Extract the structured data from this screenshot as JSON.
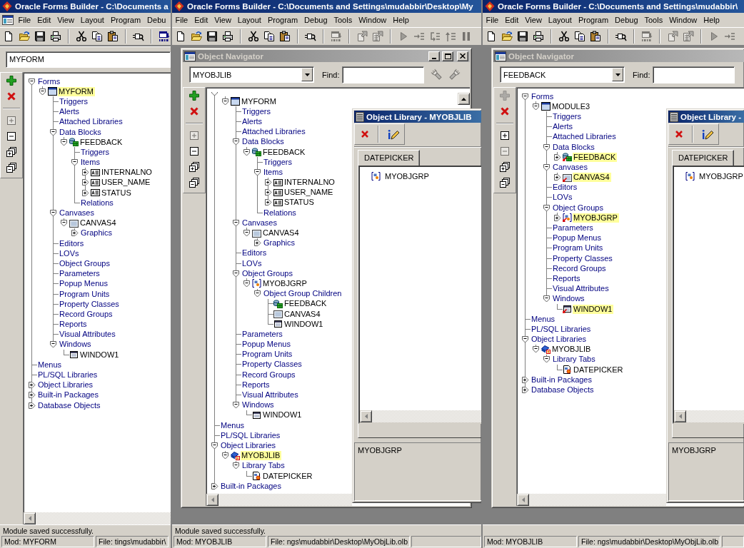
{
  "panels": [
    {
      "app_title": "Oracle Forms Builder - C:\\Documents a",
      "menu": [
        "File",
        "Edit",
        "View",
        "Layout",
        "Program",
        "Debu"
      ],
      "toolbar": [
        {
          "disabled": false
        },
        {
          "disabled": false
        },
        {
          "disabled": false
        },
        {
          "disabled": false
        },
        {
          "disabled": false
        },
        {
          "disabled": false
        },
        {
          "disabled": false
        },
        {
          "disabled": false
        },
        {
          "disabled": false
        }
      ],
      "navigator": {
        "maximized": true,
        "module": "MYFORM",
        "tools": [
          {
            "disabled": false
          },
          {
            "disabled": false
          },
          {
            "disabled": true
          },
          {
            "disabled": false
          },
          {
            "disabled": false
          },
          {
            "disabled": false
          }
        ],
        "tree": [
          {
            "label": "Forms",
            "kind": "category",
            "selected": false,
            "expanded": true,
            "children": [
              {
                "label": "MYFORM",
                "kind": "form",
                "selected": true,
                "subclassed": false,
                "expanded": true,
                "children": [
                  {
                    "label": "Triggers",
                    "kind": "category",
                    "selected": false
                  },
                  {
                    "label": "Alerts",
                    "kind": "category",
                    "selected": false
                  },
                  {
                    "label": "Attached Libraries",
                    "kind": "category",
                    "selected": false
                  },
                  {
                    "label": "Data Blocks",
                    "kind": "category",
                    "selected": false,
                    "expanded": true,
                    "children": [
                      {
                        "label": "FEEDBACK",
                        "kind": "block",
                        "selected": false,
                        "subclassed": false,
                        "expanded": true,
                        "children": [
                          {
                            "label": "Triggers",
                            "kind": "category",
                            "selected": false
                          },
                          {
                            "label": "Items",
                            "kind": "category",
                            "selected": false,
                            "expanded": true,
                            "children": [
                              {
                                "label": "INTERNALNO",
                                "kind": "item",
                                "selected": false,
                                "subclassed": false,
                                "expanded": false
                              },
                              {
                                "label": "USER_NAME",
                                "kind": "item",
                                "selected": false,
                                "subclassed": false,
                                "expanded": false
                              },
                              {
                                "label": "STATUS",
                                "kind": "item",
                                "selected": false,
                                "subclassed": false,
                                "expanded": false
                              }
                            ]
                          },
                          {
                            "label": "Relations",
                            "kind": "category",
                            "selected": false
                          }
                        ]
                      }
                    ]
                  },
                  {
                    "label": "Canvases",
                    "kind": "category",
                    "selected": false,
                    "expanded": true,
                    "children": [
                      {
                        "label": "CANVAS4",
                        "kind": "canvas",
                        "selected": false,
                        "subclassed": false,
                        "expanded": true,
                        "children": [
                          {
                            "label": "Graphics",
                            "kind": "category",
                            "selected": false,
                            "expanded": false
                          }
                        ]
                      }
                    ]
                  },
                  {
                    "label": "Editors",
                    "kind": "category",
                    "selected": false
                  },
                  {
                    "label": "LOVs",
                    "kind": "category",
                    "selected": false
                  },
                  {
                    "label": "Object Groups",
                    "kind": "category",
                    "selected": false
                  },
                  {
                    "label": "Parameters",
                    "kind": "category",
                    "selected": false
                  },
                  {
                    "label": "Popup Menus",
                    "kind": "category",
                    "selected": false
                  },
                  {
                    "label": "Program Units",
                    "kind": "category",
                    "selected": false
                  },
                  {
                    "label": "Property Classes",
                    "kind": "category",
                    "selected": false
                  },
                  {
                    "label": "Record Groups",
                    "kind": "category",
                    "selected": false
                  },
                  {
                    "label": "Reports",
                    "kind": "category",
                    "selected": false
                  },
                  {
                    "label": "Visual Attributes",
                    "kind": "category",
                    "selected": false
                  },
                  {
                    "label": "Windows",
                    "kind": "category",
                    "selected": false,
                    "expanded": true,
                    "children": [
                      {
                        "label": "WINDOW1",
                        "kind": "window",
                        "selected": false,
                        "subclassed": false
                      }
                    ]
                  }
                ]
              }
            ]
          },
          {
            "label": "Menus",
            "kind": "category",
            "selected": false
          },
          {
            "label": "PL/SQL Libraries",
            "kind": "category",
            "selected": false
          },
          {
            "label": "Object Libraries",
            "kind": "category",
            "selected": false,
            "expanded": false
          },
          {
            "label": "Built-in Packages",
            "kind": "category",
            "selected": false,
            "expanded": false
          },
          {
            "label": "Database Objects",
            "kind": "category",
            "selected": false,
            "expanded": false
          }
        ]
      },
      "status_bar": {
        "message": "Module saved successfully.",
        "fields": [
          "Mod: MYFORM",
          "File: tings\\mudabbir\\"
        ]
      }
    },
    {
      "app_title": "Oracle Forms Builder - C:\\Documents and Settings\\mudabbir\\Desktop\\My",
      "menu": [
        "File",
        "Edit",
        "View",
        "Layout",
        "Program",
        "Debug",
        "Tools",
        "Window",
        "Help"
      ],
      "toolbar": [
        {
          "disabled": false
        },
        {
          "disabled": false
        },
        {
          "disabled": false
        },
        {
          "disabled": false
        },
        {
          "disabled": false
        },
        {
          "disabled": false
        },
        {
          "disabled": false
        },
        {
          "disabled": false
        },
        {
          "disabled": true
        },
        {
          "disabled": true
        },
        {
          "disabled": true
        },
        {
          "disabled": true
        },
        {
          "disabled": true
        },
        {
          "disabled": true
        },
        {
          "disabled": true
        },
        {
          "disabled": true
        }
      ],
      "navigator": {
        "maximized": false,
        "title": "Object Navigator",
        "active": false,
        "controls": [
          {
            "kind": "minimize"
          },
          {
            "kind": "maximize"
          },
          {
            "kind": "close"
          }
        ],
        "module": "MYOBJLIB",
        "find": {
          "label": "Find:"
        },
        "search_buttons": [
          {
            "disabled": true
          },
          {
            "disabled": true
          }
        ],
        "tools": [
          {
            "disabled": false
          },
          {
            "disabled": false
          },
          {
            "disabled": true
          },
          {
            "disabled": false
          },
          {
            "disabled": false
          },
          {
            "disabled": false
          }
        ],
        "tree": [
          {
            "kind": "category",
            "expanded": true,
            "children": [
              {
                "label": "MYFORM",
                "kind": "form",
                "selected": false,
                "subclassed": false,
                "expanded": true,
                "children": [
                  {
                    "label": "Triggers",
                    "kind": "category",
                    "selected": false
                  },
                  {
                    "label": "Alerts",
                    "kind": "category",
                    "selected": false
                  },
                  {
                    "label": "Attached Libraries",
                    "kind": "category",
                    "selected": false
                  },
                  {
                    "label": "Data Blocks",
                    "kind": "category",
                    "selected": false,
                    "expanded": true,
                    "children": [
                      {
                        "label": "FEEDBACK",
                        "kind": "block",
                        "selected": false,
                        "subclassed": false,
                        "expanded": true,
                        "children": [
                          {
                            "label": "Triggers",
                            "kind": "category",
                            "selected": false
                          },
                          {
                            "label": "Items",
                            "kind": "category",
                            "selected": false,
                            "expanded": true,
                            "children": [
                              {
                                "label": "INTERNALNO",
                                "kind": "item",
                                "selected": false,
                                "subclassed": false,
                                "expanded": false
                              },
                              {
                                "label": "USER_NAME",
                                "kind": "item",
                                "selected": false,
                                "subclassed": false,
                                "expanded": false
                              },
                              {
                                "label": "STATUS",
                                "kind": "item",
                                "selected": false,
                                "subclassed": false,
                                "expanded": false
                              }
                            ]
                          },
                          {
                            "label": "Relations",
                            "kind": "category",
                            "selected": false
                          }
                        ]
                      }
                    ]
                  },
                  {
                    "label": "Canvases",
                    "kind": "category",
                    "selected": false,
                    "expanded": true,
                    "children": [
                      {
                        "label": "CANVAS4",
                        "kind": "canvas",
                        "selected": false,
                        "subclassed": false,
                        "expanded": true,
                        "children": [
                          {
                            "label": "Graphics",
                            "kind": "category",
                            "selected": false,
                            "expanded": false
                          }
                        ]
                      }
                    ]
                  },
                  {
                    "label": "Editors",
                    "kind": "category",
                    "selected": false
                  },
                  {
                    "label": "LOVs",
                    "kind": "category",
                    "selected": false
                  },
                  {
                    "label": "Object Groups",
                    "kind": "category",
                    "selected": false,
                    "expanded": true,
                    "children": [
                      {
                        "label": "MYOBJGRP",
                        "kind": "group",
                        "selected": false,
                        "subclassed": false,
                        "expanded": true,
                        "children": [
                          {
                            "label": "Object Group Children",
                            "kind": "category",
                            "selected": false,
                            "expanded": true,
                            "children": [
                              {
                                "label": "FEEDBACK",
                                "kind": "block",
                                "selected": false,
                                "subclassed": false
                              },
                              {
                                "label": "CANVAS4",
                                "kind": "canvas",
                                "selected": false,
                                "subclassed": false
                              },
                              {
                                "label": "WINDOW1",
                                "kind": "window",
                                "selected": false,
                                "subclassed": false
                              }
                            ]
                          }
                        ]
                      }
                    ]
                  },
                  {
                    "label": "Parameters",
                    "kind": "category",
                    "selected": false
                  },
                  {
                    "label": "Popup Menus",
                    "kind": "category",
                    "selected": false
                  },
                  {
                    "label": "Program Units",
                    "kind": "category",
                    "selected": false
                  },
                  {
                    "label": "Property Classes",
                    "kind": "category",
                    "selected": false
                  },
                  {
                    "label": "Record Groups",
                    "kind": "category",
                    "selected": false
                  },
                  {
                    "label": "Reports",
                    "kind": "category",
                    "selected": false
                  },
                  {
                    "label": "Visual Attributes",
                    "kind": "category",
                    "selected": false
                  },
                  {
                    "label": "Windows",
                    "kind": "category",
                    "selected": false,
                    "expanded": true,
                    "children": [
                      {
                        "label": "WINDOW1",
                        "kind": "window",
                        "selected": false,
                        "subclassed": false
                      }
                    ]
                  }
                ]
              }
            ]
          },
          {
            "label": "Menus",
            "kind": "category",
            "selected": false
          },
          {
            "label": "PL/SQL Libraries",
            "kind": "category",
            "selected": false
          },
          {
            "label": "Object Libraries",
            "kind": "category",
            "selected": false,
            "expanded": true,
            "children": [
              {
                "label": "MYOBJLIB",
                "kind": "library",
                "selected": true,
                "subclassed": false,
                "expanded": true,
                "children": [
                  {
                    "label": "Library Tabs",
                    "kind": "category",
                    "selected": false,
                    "expanded": true,
                    "children": [
                      {
                        "label": "DATEPICKER",
                        "kind": "tab",
                        "selected": false,
                        "subclassed": false
                      }
                    ]
                  }
                ]
              }
            ]
          },
          {
            "label": "Built-in Packages",
            "kind": "category",
            "selected": false,
            "expanded": false
          }
        ]
      },
      "library": {
        "title": "Object Library - MYOBJLIB",
        "active": true,
        "tabs": [
          {
            "label": "DATEPICKER",
            "selected": true
          }
        ],
        "items": [
          {
            "label": "MYOBJGRP",
            "kind": "group",
            "selected": false
          }
        ],
        "description": "MYOBJGRP"
      },
      "status_bar": {
        "message": "Module saved successfully.",
        "fields": [
          "Mod: MYOBJLIB",
          "File: ngs\\mudabbir\\Desktop\\MyObjLib.olb"
        ],
        "blank_field": true
      }
    },
    {
      "app_title": "Oracle Forms Builder - C:\\Documents and Settings\\mudabbir\\",
      "menu": [
        "File",
        "Edit",
        "View",
        "Layout",
        "Program",
        "Debug",
        "Tools",
        "Window",
        "Help"
      ],
      "toolbar": [
        {
          "disabled": false
        },
        {
          "disabled": false
        },
        {
          "disabled": false
        },
        {
          "disabled": false
        },
        {
          "disabled": false
        },
        {
          "disabled": false
        },
        {
          "disabled": false
        },
        {
          "disabled": false
        },
        {
          "disabled": true
        },
        {
          "disabled": true
        },
        {
          "disabled": true
        },
        {
          "disabled": true
        },
        {
          "disabled": true
        }
      ],
      "navigator": {
        "maximized": false,
        "title": "Object Navigator",
        "active": false,
        "module": "FEEDBACK",
        "find": {
          "label": "Find:"
        },
        "tools": [
          {
            "disabled": true
          },
          {
            "disabled": false
          },
          {
            "disabled": false
          },
          {
            "disabled": true
          },
          {
            "disabled": false
          },
          {
            "disabled": false
          }
        ],
        "tree": [
          {
            "label": "Forms",
            "kind": "category",
            "selected": false,
            "expanded": true,
            "children": [
              {
                "label": "MODULE3",
                "kind": "form",
                "selected": false,
                "subclassed": false,
                "expanded": true,
                "children": [
                  {
                    "label": "Triggers",
                    "kind": "category",
                    "selected": false
                  },
                  {
                    "label": "Alerts",
                    "kind": "category",
                    "selected": false
                  },
                  {
                    "label": "Attached Libraries",
                    "kind": "category",
                    "selected": false
                  },
                  {
                    "label": "Data Blocks",
                    "kind": "category",
                    "selected": false,
                    "expanded": true,
                    "children": [
                      {
                        "label": "FEEDBACK",
                        "kind": "block",
                        "selected": true,
                        "subclassed": true,
                        "expanded": false
                      }
                    ]
                  },
                  {
                    "label": "Canvases",
                    "kind": "category",
                    "selected": false,
                    "expanded": true,
                    "children": [
                      {
                        "label": "CANVAS4",
                        "kind": "canvas",
                        "selected": true,
                        "subclassed": true,
                        "expanded": false
                      }
                    ]
                  },
                  {
                    "label": "Editors",
                    "kind": "category",
                    "selected": false
                  },
                  {
                    "label": "LOVs",
                    "kind": "category",
                    "selected": false
                  },
                  {
                    "label": "Object Groups",
                    "kind": "category",
                    "selected": false,
                    "expanded": true,
                    "children": [
                      {
                        "label": "MYOBJGRP",
                        "kind": "group",
                        "selected": true,
                        "subclassed": true,
                        "expanded": false
                      }
                    ]
                  },
                  {
                    "label": "Parameters",
                    "kind": "category",
                    "selected": false
                  },
                  {
                    "label": "Popup Menus",
                    "kind": "category",
                    "selected": false
                  },
                  {
                    "label": "Program Units",
                    "kind": "category",
                    "selected": false
                  },
                  {
                    "label": "Property Classes",
                    "kind": "category",
                    "selected": false
                  },
                  {
                    "label": "Record Groups",
                    "kind": "category",
                    "selected": false
                  },
                  {
                    "label": "Reports",
                    "kind": "category",
                    "selected": false
                  },
                  {
                    "label": "Visual Attributes",
                    "kind": "category",
                    "selected": false
                  },
                  {
                    "label": "Windows",
                    "kind": "category",
                    "selected": false,
                    "expanded": true,
                    "children": [
                      {
                        "label": "WINDOW1",
                        "kind": "window",
                        "selected": true,
                        "subclassed": true
                      }
                    ]
                  }
                ]
              }
            ]
          },
          {
            "label": "Menus",
            "kind": "category",
            "selected": false
          },
          {
            "label": "PL/SQL Libraries",
            "kind": "category",
            "selected": false
          },
          {
            "label": "Object Libraries",
            "kind": "category",
            "selected": false,
            "expanded": true,
            "children": [
              {
                "label": "MYOBJLIB",
                "kind": "library",
                "selected": false,
                "subclassed": false,
                "expanded": true,
                "children": [
                  {
                    "label": "Library Tabs",
                    "kind": "category",
                    "selected": false,
                    "expanded": true,
                    "children": [
                      {
                        "label": "DATEPICKER",
                        "kind": "tab",
                        "selected": false,
                        "subclassed": false
                      }
                    ]
                  }
                ]
              }
            ]
          },
          {
            "label": "Built-in Packages",
            "kind": "category",
            "selected": false,
            "expanded": false
          },
          {
            "label": "Database Objects",
            "kind": "category",
            "selected": false,
            "expanded": false
          }
        ]
      },
      "library": {
        "title": "Object Library -",
        "active": true,
        "tabs": [
          {
            "label": "DATEPICKER",
            "selected": true
          }
        ],
        "items": [
          {
            "label": "MYOBJGRP",
            "kind": "group",
            "selected": false
          }
        ],
        "description": "MYOBJGRP"
      },
      "status_bar": {
        "fields": [
          "Mod: MYOBJLIB",
          "File: ngs\\mudabbir\\Desktop\\MyObjLib.olb"
        ],
        "blank_field": true
      }
    }
  ]
}
